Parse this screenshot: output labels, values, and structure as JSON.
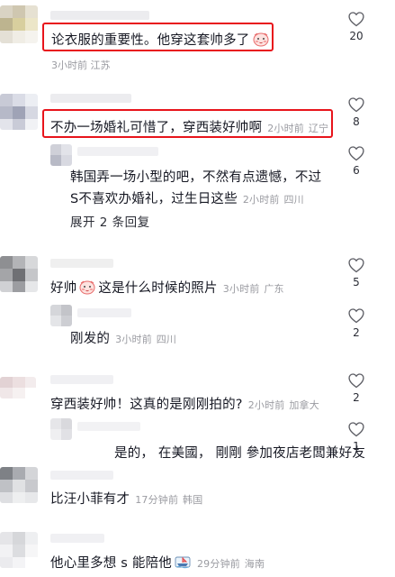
{
  "comments": [
    {
      "text": "论衣服的重要性。他穿这套帅多了",
      "time": "3小时前",
      "location": "江苏",
      "likes": "20",
      "emoji": "blush-face-icon"
    },
    {
      "text": "不办一场婚礼可惜了，穿西装好帅啊",
      "time": "2小时前",
      "location": "辽宁",
      "likes": "8"
    },
    {
      "line1": "韩国弄一场小型的吧，不然有点遗憾，不过",
      "line2": "S不喜欢办婚礼，过生日这些",
      "time": "2小时前",
      "location": "四川",
      "likes": "6",
      "expand": "展开 2 条回复"
    },
    {
      "text": "好帅",
      "text_after": "这是什么时候的照片",
      "time": "3小时前",
      "location": "广东",
      "likes": "5",
      "emoji": "blush-face-icon"
    },
    {
      "text": "刚发的",
      "time": "3小时前",
      "location": "四川",
      "likes": "2"
    },
    {
      "text": "穿西装好帅！这真的是刚刚拍的?",
      "time": "2小时前",
      "location": "加拿大",
      "likes": "2"
    },
    {
      "text": "是的，  在美國，  剛剛  參加夜店老闆兼好友",
      "likes": "1"
    },
    {
      "text": "比汪小菲有才",
      "time": "17分钟前",
      "location": "韩国"
    },
    {
      "text": "他心里多想 s 能陪他",
      "time": "29分钟前",
      "location": "海南",
      "emoji": "boat-icon"
    }
  ],
  "colors": {
    "highlight": "#e8141b",
    "meta": "#9a9ba1",
    "text": "#161823"
  }
}
